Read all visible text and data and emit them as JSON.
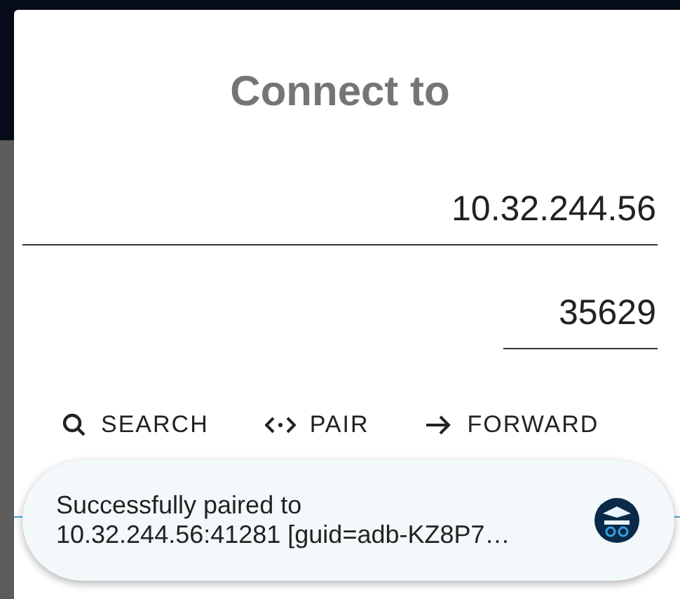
{
  "dialog": {
    "title": "Connect to",
    "host_field": {
      "value": "10.32.244.56"
    },
    "port_field": {
      "value": "35629"
    },
    "buttons": [
      {
        "kind": "search",
        "label": "SEARCH"
      },
      {
        "kind": "pair",
        "label": "PAIR"
      },
      {
        "kind": "forward",
        "label": "FORWARD"
      }
    ]
  },
  "toast": {
    "text": "Successfully paired to\n10.32.244.56:41281 [guid=adb-KZ8P7…"
  }
}
